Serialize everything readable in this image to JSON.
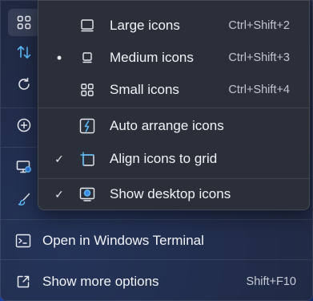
{
  "submenu": {
    "items": [
      {
        "label": "Large icons",
        "shortcut": "Ctrl+Shift+2",
        "icon": "large-icons-icon",
        "mark": ""
      },
      {
        "label": "Medium icons",
        "shortcut": "Ctrl+Shift+3",
        "icon": "medium-icons-icon",
        "mark": "•"
      },
      {
        "label": "Small icons",
        "shortcut": "Ctrl+Shift+4",
        "icon": "small-icons-icon",
        "mark": ""
      },
      {
        "label": "Auto arrange icons",
        "shortcut": "",
        "icon": "auto-arrange-icon",
        "mark": ""
      },
      {
        "label": "Align icons to grid",
        "shortcut": "",
        "icon": "align-grid-icon",
        "mark": "✓"
      },
      {
        "label": "Show desktop icons",
        "shortcut": "",
        "icon": "show-desktop-icon",
        "mark": "✓"
      }
    ]
  },
  "menu": {
    "rail_icons": [
      "view-grid-icon",
      "sort-icon",
      "refresh-icon",
      "new-icon",
      "display-settings-icon",
      "personalize-icon"
    ],
    "terminal": {
      "label": "Open in Windows Terminal",
      "icon": "terminal-icon"
    },
    "more_options": {
      "label": "Show more options",
      "shortcut": "Shift+F10",
      "icon": "more-options-icon"
    }
  },
  "colors": {
    "accent": "#4cc2ff",
    "menu_bg": "#2a2f3a",
    "text": "#f2f3f6"
  }
}
